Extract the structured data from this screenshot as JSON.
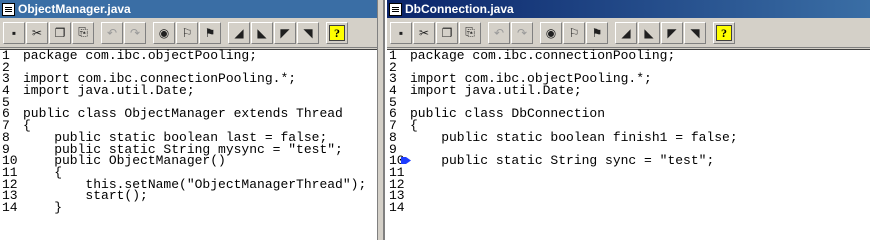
{
  "windows": [
    {
      "title": "ObjectManager.java",
      "lines": [
        {
          "n": "1",
          "code": "package com.ibc.objectPooling;"
        },
        {
          "n": "2",
          "code": ""
        },
        {
          "n": "3",
          "code": "import com.ibc.connectionPooling.*;"
        },
        {
          "n": "4",
          "code": "import java.util.Date;"
        },
        {
          "n": "5",
          "code": ""
        },
        {
          "n": "6",
          "code": "public class ObjectManager extends Thread"
        },
        {
          "n": "7",
          "code": "{"
        },
        {
          "n": "8",
          "code": "    public static boolean last = false;"
        },
        {
          "n": "9",
          "code": "    public static String mysync = \"test\";"
        },
        {
          "n": "10",
          "code": "    public ObjectManager()"
        },
        {
          "n": "11",
          "code": "    {"
        },
        {
          "n": "12",
          "code": "        this.setName(\"ObjectManagerThread\");"
        },
        {
          "n": "13",
          "code": "        start();"
        },
        {
          "n": "14",
          "code": "    }"
        }
      ]
    },
    {
      "title": "DbConnection.java",
      "lines": [
        {
          "n": "1",
          "code": "package com.ibc.connectionPooling;"
        },
        {
          "n": "2",
          "code": ""
        },
        {
          "n": "3",
          "code": "import com.ibc.objectPooling.*;"
        },
        {
          "n": "4",
          "code": "import java.util.Date;"
        },
        {
          "n": "5",
          "code": ""
        },
        {
          "n": "6",
          "code": "public class DbConnection"
        },
        {
          "n": "7",
          "code": "{"
        },
        {
          "n": "8",
          "code": "    public static boolean finish1 = false;"
        },
        {
          "n": "9",
          "code": ""
        },
        {
          "n": "10",
          "code": "    public static String sync = \"test\";"
        },
        {
          "n": "11",
          "code": ""
        },
        {
          "n": "12",
          "code": ""
        },
        {
          "n": "13",
          "code": ""
        },
        {
          "n": "14",
          "code": ""
        }
      ]
    }
  ],
  "toolbar": [
    {
      "name": "save",
      "glyph": "▪",
      "icon": "save-icon"
    },
    {
      "name": "cut",
      "glyph": "✂",
      "icon": "cut-icon"
    },
    {
      "name": "copy",
      "glyph": "❐",
      "icon": "copy-icon"
    },
    {
      "name": "paste",
      "glyph": "⎘",
      "icon": "paste-icon"
    },
    {
      "name": "undo",
      "glyph": "↶",
      "icon": "undo-icon"
    },
    {
      "name": "redo",
      "glyph": "↷",
      "icon": "redo-icon"
    },
    {
      "name": "find",
      "glyph": "◉",
      "icon": "binoculars-icon"
    },
    {
      "name": "find-next",
      "glyph": "⚐",
      "icon": "find-next-icon"
    },
    {
      "name": "find-previous",
      "glyph": "⚑",
      "icon": "find-previous-icon"
    },
    {
      "name": "toggle-bookmark",
      "glyph": "◢",
      "icon": "bookmark-icon"
    },
    {
      "name": "next-bookmark",
      "glyph": "◣",
      "icon": "next-bookmark-icon"
    },
    {
      "name": "previous-bookmark",
      "glyph": "◤",
      "icon": "previous-bookmark-icon"
    },
    {
      "name": "clear-bookmarks",
      "glyph": "◥",
      "icon": "clear-bookmarks-icon"
    },
    {
      "name": "help",
      "glyph": "?",
      "icon": "help-icon"
    }
  ],
  "colors": {
    "title_active": "#0a246a",
    "title_inactive": "#3a6ea5",
    "marker": "#1e3cff"
  },
  "breakpoint_line": "10"
}
